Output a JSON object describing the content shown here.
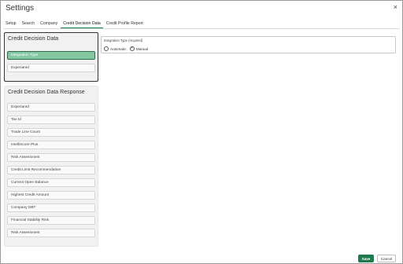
{
  "window": {
    "title": "Settings",
    "close_glyph": "×"
  },
  "tabs": [
    {
      "label": "Setup"
    },
    {
      "label": "Search"
    },
    {
      "label": "Company"
    },
    {
      "label": "Credit Decision Data",
      "active": true
    },
    {
      "label": "Credit Profile Report"
    }
  ],
  "credit_decision_data": {
    "title": "Credit Decision Data",
    "items": [
      {
        "label": "Integration Type",
        "selected": true
      },
      {
        "label": "ExperianId",
        "selected": false
      }
    ]
  },
  "credit_decision_data_response": {
    "title": "Credit Decision Data Response",
    "items": [
      "ExperianId",
      "Tax Id",
      "Trade Line Count",
      "IntelliScore Plus",
      "Risk Assessment",
      "Credit Limit Recommendation",
      "Current Open Balance",
      "Highest Credit Amount",
      "Company DBT",
      "Financial Stability Risk",
      "Risk Assessment"
    ]
  },
  "integration_type": {
    "label": "Integration Type (required)",
    "options": [
      {
        "label": "Automatic",
        "selected": false
      },
      {
        "label": "Manual",
        "selected": true
      }
    ]
  },
  "footer": {
    "save_label": "Save",
    "cancel_label": "Cancel"
  },
  "colors": {
    "accent": "#1f7a4d",
    "selected_item": "#84c8a2"
  },
  "icons": {
    "close": "close-icon",
    "radio_check": "check-icon"
  }
}
